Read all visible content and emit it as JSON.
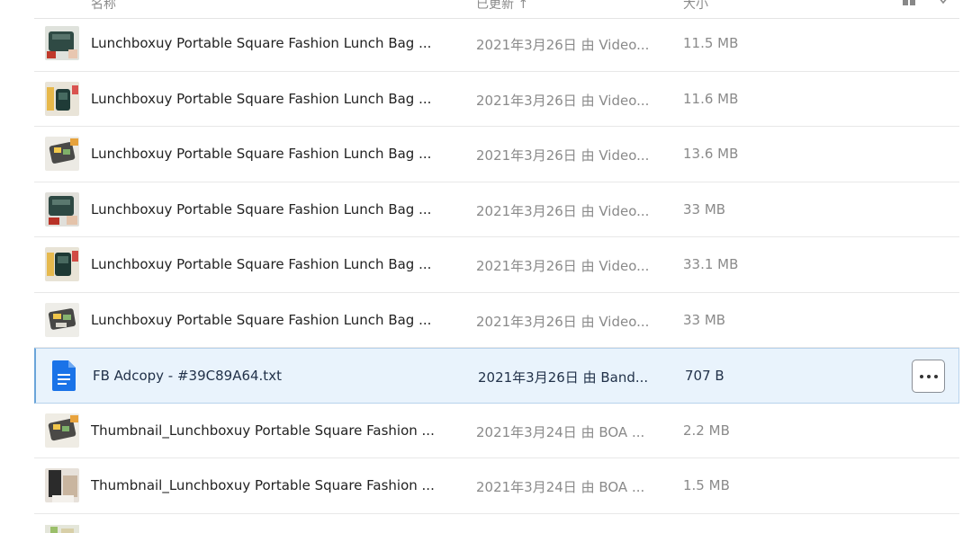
{
  "header": {
    "col_name": "名称",
    "col_updated": "已更新 ↑",
    "col_size": "大小"
  },
  "rows": [
    {
      "name": "Lunchboxuy Portable Square Fashion Lunch Bag ...",
      "updated": "2021年3月26日 由 Video...",
      "size": "11.5 MB",
      "thumb": "video-thumbnail"
    },
    {
      "name": "Lunchboxuy Portable Square Fashion Lunch Bag ...",
      "updated": "2021年3月26日 由 Video...",
      "size": "11.6 MB",
      "thumb": "video-thumbnail"
    },
    {
      "name": "Lunchboxuy Portable Square Fashion Lunch Bag ...",
      "updated": "2021年3月26日 由 Video...",
      "size": "13.6 MB",
      "thumb": "video-thumbnail"
    },
    {
      "name": "Lunchboxuy Portable Square Fashion Lunch Bag ...",
      "updated": "2021年3月26日 由 Video...",
      "size": "33 MB",
      "thumb": "video-thumbnail"
    },
    {
      "name": "Lunchboxuy Portable Square Fashion Lunch Bag ...",
      "updated": "2021年3月26日 由 Video...",
      "size": "33.1 MB",
      "thumb": "video-thumbnail"
    },
    {
      "name": "Lunchboxuy Portable Square Fashion Lunch Bag ...",
      "updated": "2021年3月26日 由 Video...",
      "size": "33 MB",
      "thumb": "video-thumbnail"
    },
    {
      "name": "FB Adcopy - #39C89A64.txt",
      "updated": "2021年3月26日 由 Band...",
      "size": "707 B",
      "thumb": "document-icon",
      "selected": true
    },
    {
      "name": "Thumbnail_Lunchboxuy Portable Square Fashion ...",
      "updated": "2021年3月24日 由 BOA ...",
      "size": "2.2 MB",
      "thumb": "image-thumbnail"
    },
    {
      "name": "Thumbnail_Lunchboxuy Portable Square Fashion ...",
      "updated": "2021年3月24日 由 BOA ...",
      "size": "1.5 MB",
      "thumb": "image-thumbnail"
    }
  ],
  "colors": {
    "selected_bg": "#e9f3fc",
    "doc_blue": "#1a73e8",
    "muted_text": "#8a8a8a"
  }
}
